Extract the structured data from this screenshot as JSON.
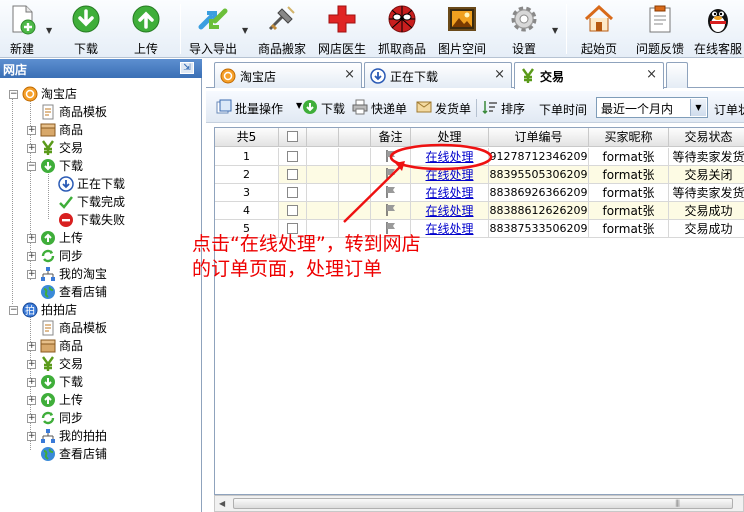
{
  "toolbar": {
    "buttons": [
      {
        "label": "新建",
        "icon": "new-doc-icon"
      },
      {
        "label": "下载",
        "icon": "download-icon"
      },
      {
        "label": "上传",
        "icon": "upload-icon"
      },
      {
        "label": "导入导出",
        "icon": "import-export-icon"
      },
      {
        "label": "商品搬家",
        "icon": "move-products-icon"
      },
      {
        "label": "网店医生",
        "icon": "shop-doctor-icon"
      },
      {
        "label": "抓取商品",
        "icon": "grab-products-icon"
      },
      {
        "label": "图片空间",
        "icon": "image-space-icon"
      },
      {
        "label": "设置",
        "icon": "gear-icon"
      },
      {
        "label": "起始页",
        "icon": "home-icon"
      },
      {
        "label": "问题反馈",
        "icon": "feedback-icon"
      },
      {
        "label": "在线客服",
        "icon": "qq-penguin-icon"
      }
    ]
  },
  "sidebar": {
    "title": "网店",
    "tree": [
      {
        "label": "淘宝店",
        "level": 0,
        "icon": "taobao-icon",
        "expander": "−"
      },
      {
        "label": "商品模板",
        "level": 1,
        "icon": "template-icon"
      },
      {
        "label": "商品",
        "level": 1,
        "icon": "box-icon",
        "expander": "+"
      },
      {
        "label": "交易",
        "level": 1,
        "icon": "yen-icon",
        "expander": "+"
      },
      {
        "label": "下载",
        "level": 1,
        "icon": "download-icon",
        "expander": "−"
      },
      {
        "label": "正在下载",
        "level": 2,
        "icon": "downloading-icon"
      },
      {
        "label": "下载完成",
        "level": 2,
        "icon": "checkmark-icon"
      },
      {
        "label": "下载失败",
        "level": 2,
        "icon": "failed-icon"
      },
      {
        "label": "上传",
        "level": 1,
        "icon": "upload-icon",
        "expander": "+"
      },
      {
        "label": "同步",
        "level": 1,
        "icon": "sync-icon",
        "expander": "+"
      },
      {
        "label": "我的淘宝",
        "level": 1,
        "icon": "network-icon",
        "expander": "+"
      },
      {
        "label": "查看店铺",
        "level": 1,
        "icon": "globe-icon"
      },
      {
        "label": "拍拍店",
        "level": 0,
        "icon": "paipai-icon",
        "expander": "−"
      },
      {
        "label": "商品模板",
        "level": 1,
        "icon": "template-icon"
      },
      {
        "label": "商品",
        "level": 1,
        "icon": "box-icon",
        "expander": "+"
      },
      {
        "label": "交易",
        "level": 1,
        "icon": "yen-icon",
        "expander": "+"
      },
      {
        "label": "下载",
        "level": 1,
        "icon": "download-icon",
        "expander": "+"
      },
      {
        "label": "上传",
        "level": 1,
        "icon": "upload-icon",
        "expander": "+"
      },
      {
        "label": "同步",
        "level": 1,
        "icon": "sync-icon",
        "expander": "+"
      },
      {
        "label": "我的拍拍",
        "level": 1,
        "icon": "network-icon",
        "expander": "+"
      },
      {
        "label": "查看店铺",
        "level": 1,
        "icon": "globe-icon"
      }
    ]
  },
  "tabs": [
    {
      "label": "淘宝店",
      "icon": "taobao-icon",
      "close": "×"
    },
    {
      "label": "正在下载",
      "icon": "downloading-icon",
      "close": "×"
    },
    {
      "label": "交易",
      "icon": "yen-icon",
      "close": "×"
    }
  ],
  "subtoolbar": {
    "batch_label": "批量操作",
    "download_label": "下载",
    "express_label": "快递单",
    "ship_label": "发货单",
    "sort_label": "排序",
    "order_time_label": "下单时间",
    "order_time_value": "最近一个月内",
    "order_status_label": "订单状"
  },
  "grid": {
    "count_label": "共5",
    "columns": [
      "备注",
      "处理",
      "订单编号",
      "买家昵称",
      "交易状态"
    ],
    "rows": [
      {
        "no": "1",
        "action": "在线处理",
        "order_id": "91278712346209",
        "buyer": "format张",
        "status": "等待卖家发货"
      },
      {
        "no": "2",
        "action": "在线处理",
        "order_id": "88395505306209",
        "buyer": "format张",
        "status": "交易关闭"
      },
      {
        "no": "3",
        "action": "在线处理",
        "order_id": "88386926366209",
        "buyer": "format张",
        "status": "等待卖家发货"
      },
      {
        "no": "4",
        "action": "在线处理",
        "order_id": "88388612626209",
        "buyer": "format张",
        "status": "交易成功"
      },
      {
        "no": "5",
        "action": "在线处理",
        "order_id": "88387533506209",
        "buyer": "format张",
        "status": "交易成功"
      }
    ]
  },
  "annotation": {
    "text_line1": "点击“在线处理”，转到网店",
    "text_line2": "的订单页面，处理订单",
    "color": "#ee0000"
  }
}
